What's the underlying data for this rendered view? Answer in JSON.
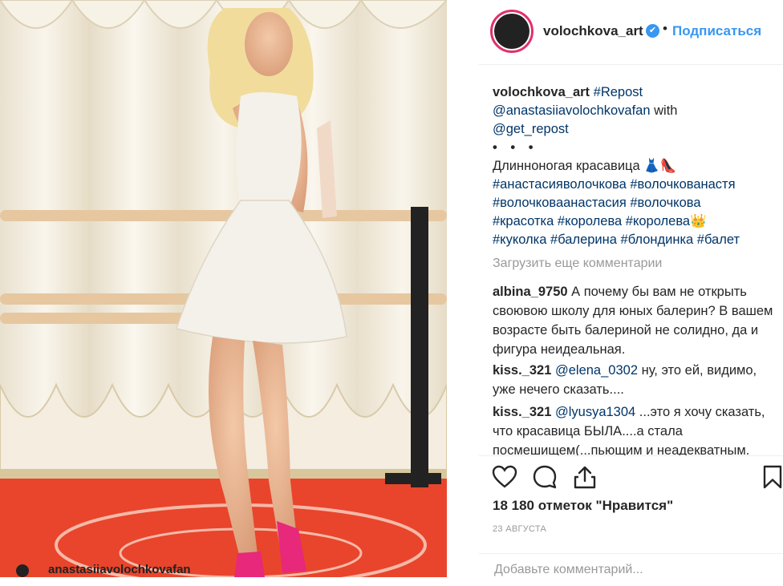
{
  "post": {
    "username": "volochkova_art",
    "follow_label": "Подписаться",
    "separator": "•",
    "verified_mark": "✔"
  },
  "caption": {
    "username": "volochkova_art",
    "line1_rest": " #Repost",
    "line2": "@anastasiiavolochkovafan",
    "line2_rest": " with",
    "line3": "@get_repost",
    "dots": "• • •",
    "text": "Длинноногая красавица 👗👠",
    "tags_line1": "#анастасияволочкова #волочкованастя",
    "tags_line2": "#волочковаанастасия #волочкова",
    "tags_line3": "#красотка #королева #королева👑",
    "tags_line4": "#куколка #балерина #блондинка #балет"
  },
  "load_more_label": "Загрузить еще комментарии",
  "comments": [
    {
      "user": "albina_9750",
      "text": " А почему бы вам не открыть своювою школу для юных балерин? В вашем возрасте быть балериной не солидно, да и фигура неидеальная."
    },
    {
      "user": "kiss._321",
      "mention": " @elena_0302",
      "text": " ну, это ей, видимо, уже нечего сказать...."
    },
    {
      "user": "kiss._321",
      "mention": " @lyusya1304",
      "text": " ...это я хочу сказать, что красавица БЫЛА....а стала посмешищем(...пьющим и неадекватным."
    }
  ],
  "likes_label": "18 180 отметок \"Нравится\"",
  "date_label": "23 августа",
  "add_comment_placeholder": "Добавьте комментарий...",
  "overlay_text": "anastasiiavolochkovafan",
  "icons": [
    "heart-icon",
    "comment-icon",
    "share-icon",
    "bookmark-icon"
  ],
  "colors": {
    "accent": "#3897f0",
    "text": "#262626",
    "muted": "#999999",
    "floor": "#e8452c",
    "dress": "#f4f1ea",
    "shoes": "#e8287a"
  }
}
